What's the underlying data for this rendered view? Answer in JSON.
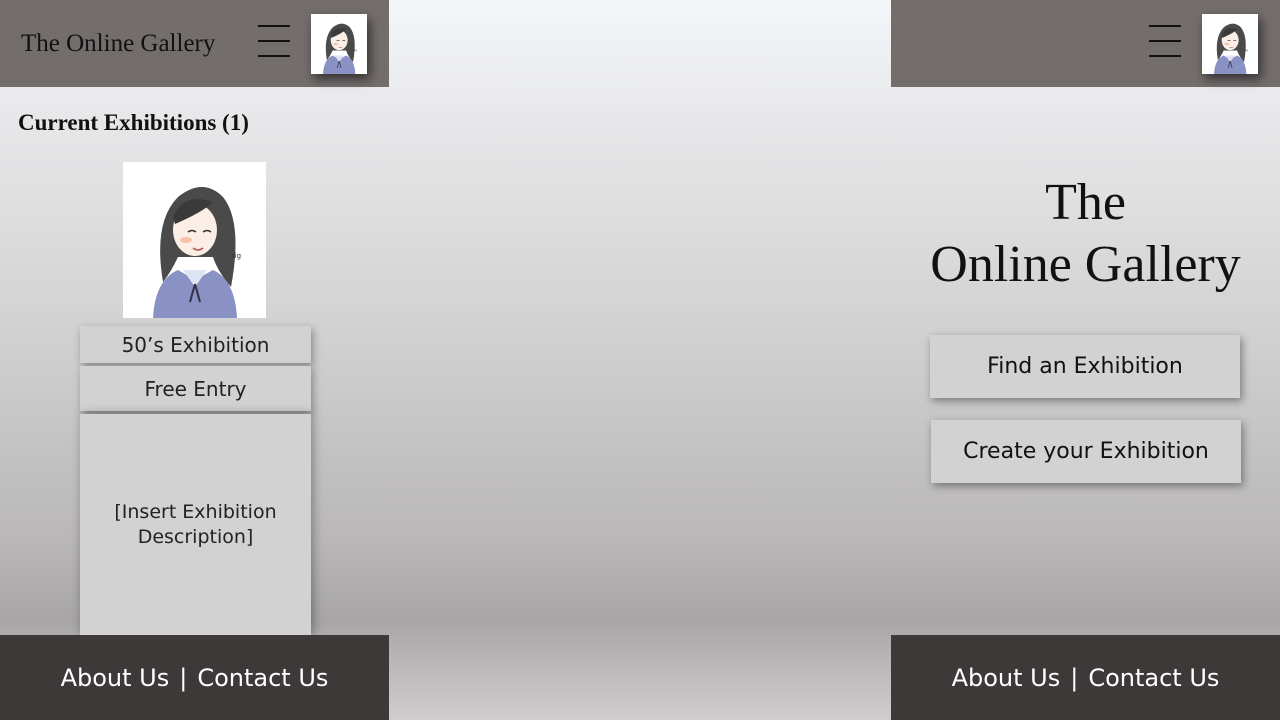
{
  "left_panel": {
    "header": {
      "brand": "The Online Gallery",
      "menu_icon": "hamburger-menu-icon",
      "avatar_icon": "user-avatar-portrait"
    },
    "section_title": "Current Exhibitions (1)",
    "exhibition": {
      "image_icon": "exhibition-portrait-image",
      "name": "50’s Exhibition",
      "entry": "Free Entry",
      "description": "[Insert Exhibition Description]"
    },
    "footer": {
      "about": "About Us",
      "separator": "|",
      "contact": "Contact Us"
    }
  },
  "right_panel": {
    "header": {
      "menu_icon": "hamburger-menu-icon",
      "avatar_icon": "user-avatar-portrait"
    },
    "hero": {
      "title_line1": "The",
      "title_line2": "Online Gallery"
    },
    "buttons": {
      "find": "Find an Exhibition",
      "create": "Create your Exhibition"
    },
    "footer": {
      "about": "About Us",
      "separator": "|",
      "contact": "Contact Us"
    }
  },
  "colors": {
    "header_bg": "#736d6c",
    "footer_bg": "#3d3939",
    "card_bg": "#d3d2d3"
  }
}
